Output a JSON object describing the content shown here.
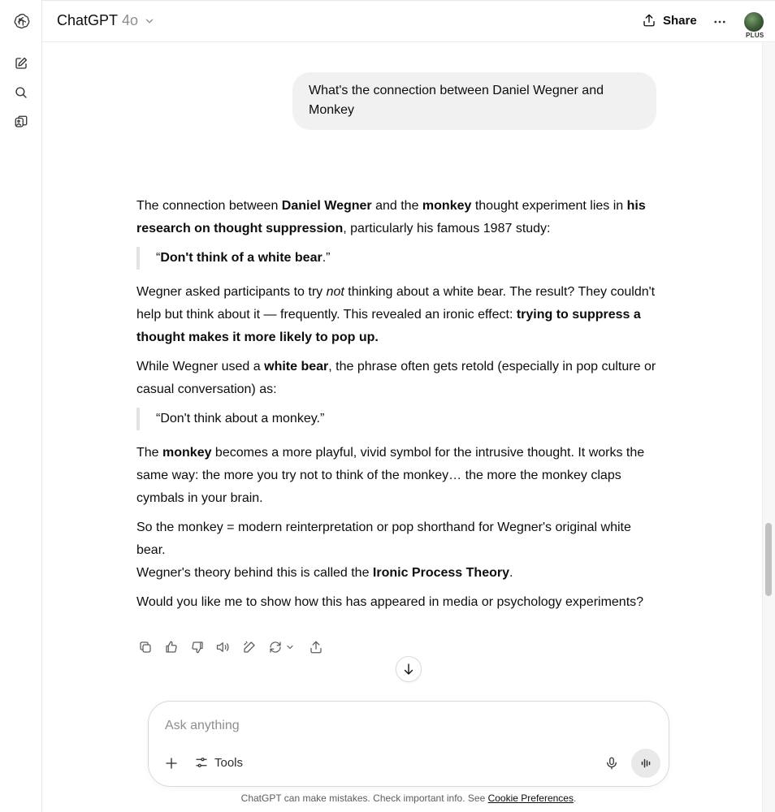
{
  "rail": {
    "icons": [
      "openai-logo-icon",
      "new-chat-icon",
      "search-icon",
      "library-icon"
    ]
  },
  "header": {
    "model_name": "ChatGPT",
    "model_version": "4o",
    "share_label": "Share",
    "plan_badge": "PLUS"
  },
  "conversation": {
    "user_message": "What's the connection between Daniel Wegner and Monkey",
    "answer": {
      "p1": {
        "t1": "The connection between ",
        "b1": "Daniel Wegner",
        "t2": " and the ",
        "b2": "monkey",
        "t3": " thought experiment lies in ",
        "b3": "his research on thought suppression",
        "t4": ", particularly his famous 1987 study:"
      },
      "quote1": {
        "open": "“",
        "bold": "Don't think of a white bear",
        "close": ".”"
      },
      "p2": {
        "t1": "Wegner asked participants to try ",
        "i1": "not",
        "t2": " thinking about a white bear. The result? They couldn't help but think about it — frequently. This revealed an ironic effect: ",
        "b1": "trying to suppress a thought makes it more likely to pop up."
      },
      "p3": {
        "t1": "While Wegner used a ",
        "b1": "white bear",
        "t2": ", the phrase often gets retold (especially in pop culture or casual conversation) as:"
      },
      "quote2": "“Don't think about a monkey.”",
      "p4": {
        "t1": "The ",
        "b1": "monkey",
        "t2": " becomes a more playful, vivid symbol for the intrusive thought. It works the same way: the more you try not to think of the monkey… the more the monkey claps cymbals in your brain."
      },
      "p5": "So the monkey = modern reinterpretation or pop shorthand for Wegner's original white bear.",
      "p6": {
        "t1": "Wegner's theory behind this is called the ",
        "b1": "Ironic Process Theory",
        "t2": "."
      },
      "p7": "Would you like me to show how this has appeared in media or psychology experiments?"
    },
    "actions": [
      "copy-icon",
      "thumbs-up-icon",
      "thumbs-down-icon",
      "read-aloud-icon",
      "edit-in-canvas-icon",
      "regenerate-icon",
      "share-icon"
    ]
  },
  "composer": {
    "placeholder": "Ask anything",
    "tools_label": "Tools"
  },
  "footer": {
    "text": "ChatGPT can make mistakes. Check important info. See ",
    "link": "Cookie Preferences",
    "end": "."
  },
  "colors": {
    "bubble_bg": "#f1f1f1",
    "text": "#0d0d0d",
    "muted": "#8e8e8e",
    "quote_border": "#e3e3e3"
  }
}
